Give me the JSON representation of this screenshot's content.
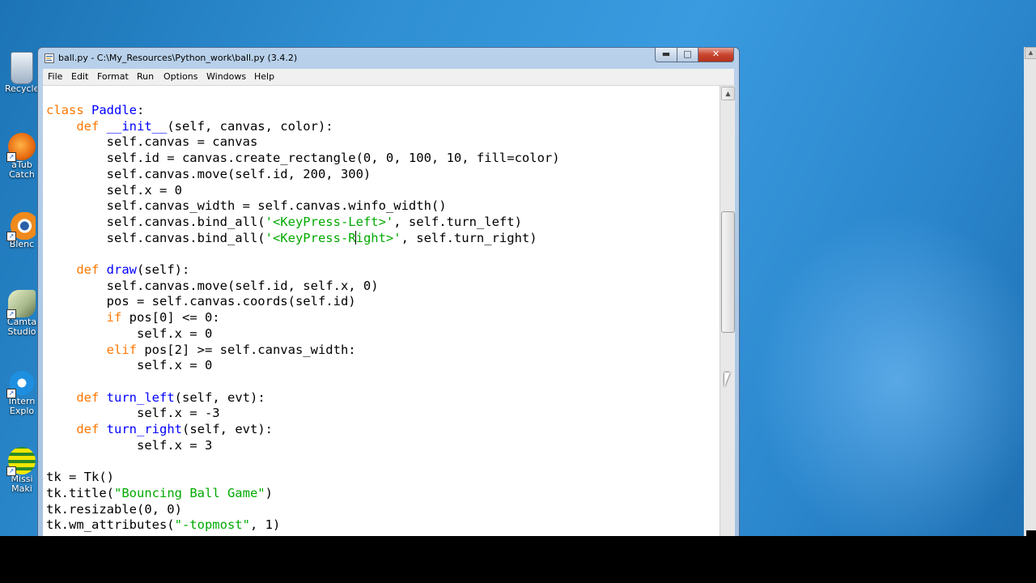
{
  "window": {
    "title": "ball.py - C:\\My_Resources\\Python_work\\ball.py (3.4.2)",
    "minimize_label": "▬",
    "maximize_label": "□",
    "close_label": "✕"
  },
  "menu": [
    "File",
    "Edit",
    "Format",
    "Run",
    "Options",
    "Windows",
    "Help"
  ],
  "desktop_icons": [
    {
      "label": "Recycle",
      "icon": "recycle-bin-icon"
    },
    {
      "label": "aTub\nCatch",
      "icon": "atube-catcher-icon"
    },
    {
      "label": "Blenc",
      "icon": "blender-icon"
    },
    {
      "label": "Camta\nStudio",
      "icon": "camtasia-icon"
    },
    {
      "label": "Intern\nExplo",
      "icon": "internet-explorer-icon"
    },
    {
      "label": "Missi\nMaki",
      "icon": "mission-maker-icon"
    }
  ],
  "code": {
    "cursor_line": 8,
    "lines": [
      "class Paddle:",
      "    def __init__(self, canvas, color):",
      "        self.canvas = canvas",
      "        self.id = canvas.create_rectangle(0, 0, 100, 10, fill=color)",
      "        self.canvas.move(self.id, 200, 300)",
      "        self.x = 0",
      "        self.canvas_width = self.canvas.winfo_width()",
      "        self.canvas.bind_all('<KeyPress-Left>', self.turn_left)",
      "        self.canvas.bind_all('<KeyPress-Right>', self.turn_right)",
      "",
      "    def draw(self):",
      "        self.canvas.move(self.id, self.x, 0)",
      "        pos = self.canvas.coords(self.id)",
      "        if pos[0] <= 0:",
      "            self.x = 0",
      "        elif pos[2] >= self.canvas_width:",
      "            self.x = 0",
      "",
      "    def turn_left(self, evt):",
      "            self.x = -3",
      "    def turn_right(self, evt):",
      "            self.x = 3",
      "",
      "tk = Tk()",
      "tk.title(\"Bouncing Ball Game\")",
      "tk.resizable(0, 0)",
      "tk.wm_attributes(\"-topmost\", 1)"
    ]
  },
  "colors": {
    "keyword": "#ff7700",
    "definition": "#0000ff",
    "string": "#00aa00",
    "text": "#000000",
    "editor_bg": "#ffffff"
  }
}
